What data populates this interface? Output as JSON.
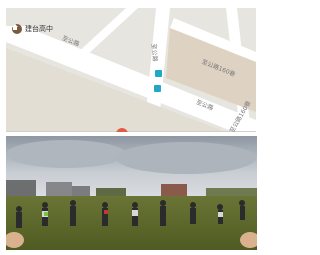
{
  "header": {
    "title": ""
  },
  "map": {
    "poi_label": "建台高中",
    "road_labels": [
      "至公路",
      "至公路",
      "至公路",
      "至公路160巷",
      "至公路160巷"
    ],
    "accent_water": "#b8d7e6",
    "bus_icon_color": "#20a8c8",
    "pin_color": "#e25b45"
  },
  "panorama": {
    "sky_color": "#9aa3ad",
    "grass_color": "#5d6b2a"
  }
}
